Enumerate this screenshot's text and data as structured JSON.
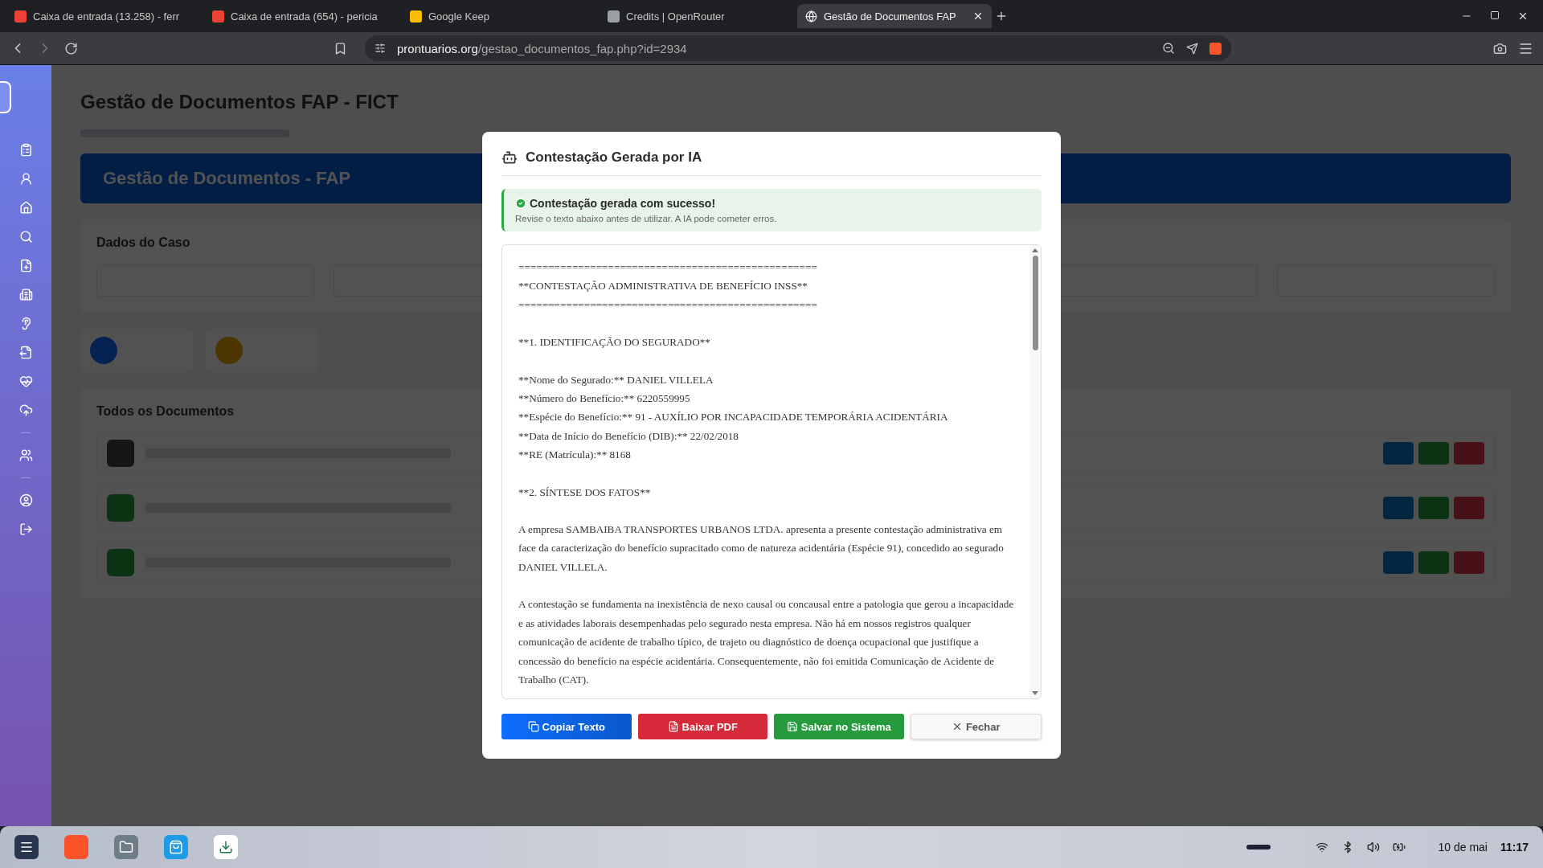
{
  "browser": {
    "tabs": [
      {
        "title": "Caixa de entrada (13.258) - ferr",
        "selected": false
      },
      {
        "title": "Caixa de entrada (654) - pericia",
        "selected": false
      },
      {
        "title": "Google Keep",
        "selected": false
      },
      {
        "title": "Credits | OpenRouter",
        "selected": false
      },
      {
        "title": "Gestão de Documentos FAP",
        "selected": true
      }
    ],
    "url_host": "prontuarios.org",
    "url_path": "/gestao_documentos_fap.php?id=2934"
  },
  "page": {
    "title": "Gestão de Documentos FAP - FICT",
    "banner_title": "Gestão de Documentos - FAP",
    "case_card_title": "Dados do Caso",
    "documents_title": "Todos os Documentos"
  },
  "modal": {
    "title": "Contestação Gerada por IA",
    "alert": {
      "title": "Contestação gerada com sucesso!",
      "message": "Revise o texto abaixo antes de utilizar. A IA pode cometer erros."
    },
    "document": [
      {
        "text": "==================================================",
        "space_before": false
      },
      {
        "text": "**CONTESTAÇÃO ADMINISTRATIVA DE BENEFÍCIO INSS**",
        "space_before": false
      },
      {
        "text": "==================================================",
        "space_before": false
      },
      {
        "text": "**1. IDENTIFICAÇÃO DO SEGURADO**",
        "space_before": true
      },
      {
        "text": "**Nome do Segurado:** DANIEL VILLELA",
        "space_before": true
      },
      {
        "text": "**Número do Benefício:** 6220559995",
        "space_before": false
      },
      {
        "text": "**Espécie do Benefício:** 91 - AUXÍLIO POR INCAPACIDADE TEMPORÁRIA ACIDENTÁRIA",
        "space_before": false
      },
      {
        "text": "**Data de Início do Benefício (DIB):** 22/02/2018",
        "space_before": false
      },
      {
        "text": "**RE (Matrícula):** 8168",
        "space_before": false
      },
      {
        "text": "**2. SÍNTESE DOS FATOS**",
        "space_before": true
      },
      {
        "text": "A empresa SAMBAIBA TRANSPORTES URBANOS LTDA. apresenta a presente contestação administrativa em face da caracterização do benefício supracitado como de natureza acidentária (Espécie 91), concedido ao segurado DANIEL VILLELA.",
        "space_before": true
      },
      {
        "text": "A contestação se fundamenta na inexistência de nexo causal ou concausal entre a patologia que gerou a incapacidade e as atividades laborais desempenhadas pelo segurado nesta empresa. Não há em nossos registros qualquer comunicação de acidente de trabalho típico, de trajeto ou diagnóstico de doença ocupacional que justifique a concessão do benefício na espécie acidentária. Consequentemente, não foi emitida Comunicação de Acidente de Trabalho (CAT).",
        "space_before": true
      }
    ],
    "buttons": [
      {
        "label": "Copiar Texto",
        "kind": "copy"
      },
      {
        "label": "Baixar PDF",
        "kind": "pdf"
      },
      {
        "label": "Salvar no Sistema",
        "kind": "save"
      },
      {
        "label": "Fechar",
        "kind": "close"
      }
    ]
  },
  "taskbar": {
    "date": "10 de mai",
    "time": "11:17"
  }
}
